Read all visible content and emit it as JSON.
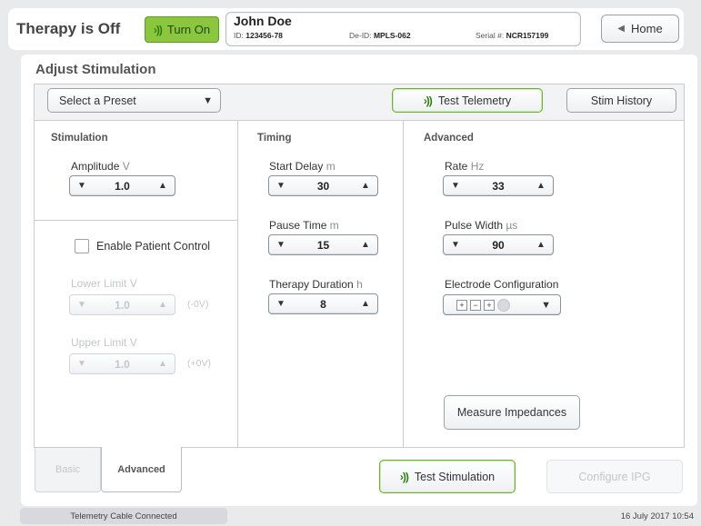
{
  "header": {
    "therapy_status": "Therapy is Off",
    "turn_on_label": "Turn On",
    "patient": {
      "name": "John Doe",
      "id_label": "ID:",
      "id": "123456-78",
      "deid_label": "De-ID:",
      "deid": "MPLS-062",
      "serial_label": "Serial #:",
      "serial": "NCR157199"
    },
    "home_label": "Home"
  },
  "panel": {
    "title": "Adjust Stimulation",
    "preset_placeholder": "Select a Preset",
    "test_telemetry_label": "Test Telemetry",
    "stim_history_label": "Stim History"
  },
  "stimulation": {
    "title": "Stimulation",
    "amplitude_label": "Amplitude",
    "amplitude_unit": "V",
    "amplitude_value": "1.0",
    "enable_patient_control_label": "Enable Patient Control",
    "lower_limit_label": "Lower Limit",
    "lower_limit_unit": "V",
    "lower_limit_value": "1.0",
    "lower_limit_offset": "(-0V)",
    "upper_limit_label": "Upper Limit",
    "upper_limit_unit": "V",
    "upper_limit_value": "1.0",
    "upper_limit_offset": "(+0V)"
  },
  "timing": {
    "title": "Timing",
    "start_delay_label": "Start Delay",
    "start_delay_unit": "m",
    "start_delay_value": "30",
    "pause_time_label": "Pause Time",
    "pause_time_unit": "m",
    "pause_time_value": "15",
    "therapy_duration_label": "Therapy Duration",
    "therapy_duration_unit": "h",
    "therapy_duration_value": "8"
  },
  "advanced": {
    "title": "Advanced",
    "rate_label": "Rate",
    "rate_unit": "Hz",
    "rate_value": "33",
    "pulse_width_label": "Pulse Width",
    "pulse_width_unit": "µs",
    "pulse_width_value": "90",
    "electrode_label": "Electrode Configuration",
    "electrode_symbols": [
      "+",
      "−",
      "+"
    ],
    "measure_label": "Measure Impedances"
  },
  "tabs": {
    "basic_label": "Basic",
    "advanced_label": "Advanced"
  },
  "footer_actions": {
    "test_stimulation_label": "Test Stimulation",
    "configure_ipg_label": "Configure IPG"
  },
  "status": {
    "connection": "Telemetry Cable Connected",
    "datetime": "16 July 2017 10:54"
  },
  "colors": {
    "turn_on_bg": "#8cc63f",
    "disabled_text": "#c3c6ca",
    "panel_bg": "#ffffff",
    "page_bg": "#e9eaec"
  }
}
